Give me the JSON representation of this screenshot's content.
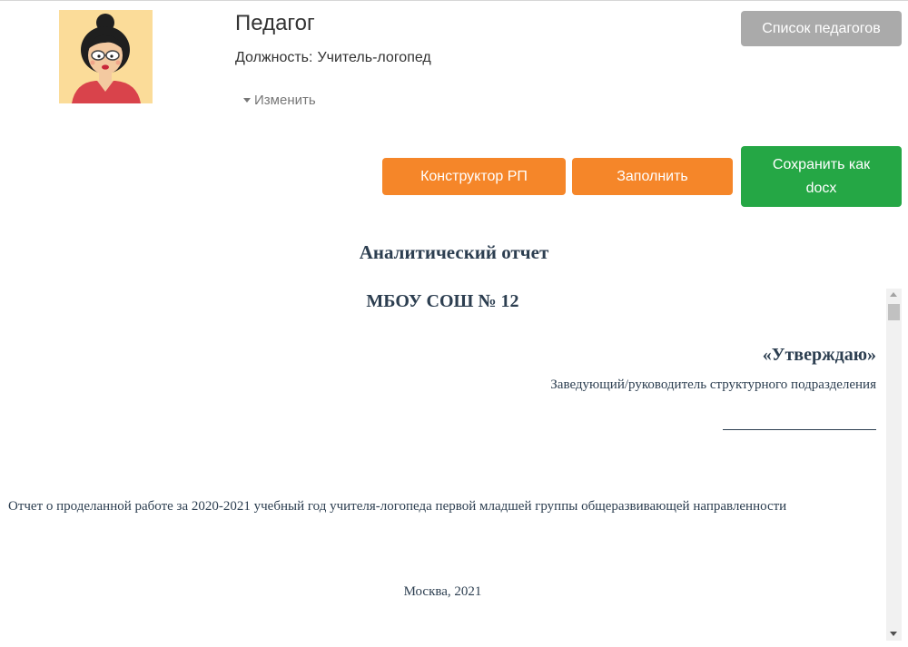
{
  "header": {
    "title": "Педагог",
    "position_label": "Должность:",
    "position_value": "Учитель-логопед",
    "change_label": "Изменить",
    "list_button": "Список педагогов",
    "avatar_icon": "teacher-cartoon-avatar"
  },
  "toolbar": {
    "constructor_label": "Конструктор РП",
    "fill_label": "Заполнить",
    "save_label": "Сохранить как docx",
    "colors": {
      "orange": "#f58629",
      "green": "#25a745",
      "gray": "#aaaaaa"
    }
  },
  "document": {
    "title": "Аналитический отчет",
    "school": "МБОУ СОШ № 12",
    "approve": "«Утверждаю»",
    "head_role": "Заведующий/руководитель структурного подразделения",
    "report_line": "Отчет о проделанной работе за 2020-2021 учебный год учителя-логопеда первой младшей группы общеразвивающей направленности",
    "city_year": "Москва, 2021"
  }
}
